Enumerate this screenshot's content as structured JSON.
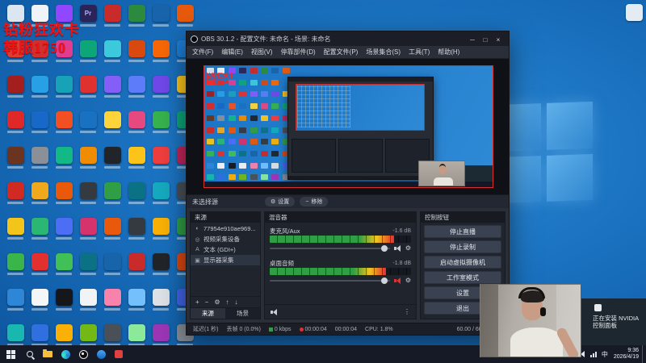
{
  "colors": {
    "overlay_text": "#f01313",
    "desktop_blue": "#1a72c0",
    "obs_background": "#2a2e38",
    "selection_red": "#d62f2f",
    "meter_green": "#2f9e44",
    "taskbar": "#161926"
  },
  "overlay": {
    "line1": "钻粉狂欢卡",
    "line2": "韩服1750"
  },
  "desktop": {
    "icon_columns": [
      [
        "#dce6f0",
        "#e23a30",
        "#a41e1e",
        "#e02828",
        "#6b3420",
        "#d02a22",
        "#f3c51b",
        "#39b54a",
        "#2e86d6",
        "#18b7b0"
      ],
      [
        "#f0f3f7",
        "#d42f2f",
        "#27a0e5",
        "#1768c8",
        "#8a8f98",
        "#f0a81c",
        "#2bb673",
        "#e2302f",
        "#f5f6f8",
        "#2f6fe0"
      ],
      [
        "#9146ff",
        "#e23c8e",
        "#17a2b8",
        "#f25022",
        "#12b886",
        "#e8590c",
        "#4c6ef5",
        "#40c057",
        "#15171a",
        "#fab005"
      ],
      [
        "#2a2459",
        "#0ca678",
        "#e03131",
        "#1971c2",
        "#f08c00",
        "#343a40",
        "#d6336c",
        "#0b7285",
        "#f1f3f5",
        "#74b816"
      ],
      [
        "#c92a2a",
        "#3bc9db",
        "#845ef7",
        "#ffd43b",
        "#212529",
        "#2f9e44",
        "#e8590c",
        "#1864ab",
        "#f783ac",
        "#495057"
      ],
      [
        "#2b8a3e",
        "#d9480f",
        "#5c7cfa",
        "#e64980",
        "#fcc419",
        "#0b7285",
        "#343a40",
        "#c92a2a",
        "#74c0fc",
        "#8ce99a"
      ],
      [
        "#1864ab",
        "#f76707",
        "#7048e8",
        "#37b24d",
        "#f03e3e",
        "#15aabf",
        "#fab005",
        "#212529",
        "#dee2e6",
        "#9c36b5"
      ],
      [
        "#e8590c",
        "#1c7ed6",
        "#fcc419",
        "#0ca678",
        "#c2255c",
        "#495057",
        "#2f9e44",
        "#d9480f",
        "#4263eb",
        "#868e96"
      ]
    ],
    "glyphs": {
      "3,0": "Pr"
    }
  },
  "obs": {
    "title": "OBS 30.1.2 - 配置文件: 未命名 - 场景: 未命名",
    "window_buttons": [
      {
        "name": "minimize",
        "glyph": "─"
      },
      {
        "name": "maximize",
        "glyph": "□"
      },
      {
        "name": "close",
        "glyph": "×"
      }
    ],
    "menus": [
      "文件(F)",
      "编辑(E)",
      "视图(V)",
      "停靠部件(D)",
      "配置文件(P)",
      "场景集合(S)",
      "工具(T)",
      "帮助(H)"
    ],
    "no_source": "未选择源",
    "preview_buttons": [
      {
        "name": "properties",
        "label": "设置"
      },
      {
        "name": "remove",
        "label": "移除"
      }
    ],
    "sources_panel": {
      "title": "来源",
      "items": [
        {
          "icon": "browser",
          "label": "77954e910ae969...",
          "selected": false
        },
        {
          "icon": "camera",
          "label": "视频采集设备",
          "selected": false
        },
        {
          "icon": "text",
          "label": "文本 (GDI+)",
          "selected": false
        },
        {
          "icon": "display",
          "label": "显示器采集",
          "selected": true
        }
      ],
      "toolbar": [
        {
          "name": "add",
          "glyph": "+"
        },
        {
          "name": "remove",
          "glyph": "−"
        },
        {
          "name": "properties",
          "glyph": "⚙"
        },
        {
          "name": "move-up",
          "glyph": "↑"
        },
        {
          "name": "move-down",
          "glyph": "↓"
        }
      ],
      "tabs": [
        "来源",
        "场景"
      ]
    },
    "mixer": {
      "title": "混音器",
      "more_glyph": "⋮",
      "channels": [
        {
          "name": "麦克风/Aux",
          "db": "-1.6 dB",
          "meter": 0.88,
          "slider": 0.96,
          "muted": false
        },
        {
          "name": "桌面音频",
          "db": "-1.8 dB",
          "meter": 0.82,
          "slider": 0.96,
          "muted": true
        }
      ]
    },
    "controls": {
      "title": "控制按钮",
      "buttons": [
        {
          "name": "stop-streaming",
          "label": "停止直播"
        },
        {
          "name": "stop-recording",
          "label": "停止录制"
        },
        {
          "name": "start-virtual-camera",
          "label": "启动虚拟摄像机"
        },
        {
          "name": "studio-mode",
          "label": "工作室模式"
        },
        {
          "name": "settings",
          "label": "设置"
        },
        {
          "name": "exit",
          "label": "退出"
        }
      ]
    },
    "status": [
      {
        "label": "延迟(1 秒)"
      },
      {
        "label": "丢帧 0 (0.0%)"
      },
      {
        "icon": "square",
        "color": "#2f9e44",
        "label": "0 kbps"
      },
      {
        "icon": "dot",
        "color": "#e03131",
        "label": "00:00:04"
      },
      {
        "label": "00:00:04"
      },
      {
        "label": "CPU: 1.8%"
      },
      {
        "label": "60.00 / 60.00 FPS"
      }
    ]
  },
  "notification": {
    "text": "正在安装 NVIDIA 控制面板"
  },
  "taskbar": {
    "apps": [
      "search",
      "folder",
      "edge",
      "obs",
      "chat",
      "media"
    ],
    "tray": [
      {
        "name": "hidden-icons-chevron",
        "glyph": "∧"
      },
      {
        "name": "volume"
      },
      {
        "name": "network"
      }
    ],
    "input_indicator": "中",
    "time": "9:36",
    "date": "2026/4/19"
  }
}
